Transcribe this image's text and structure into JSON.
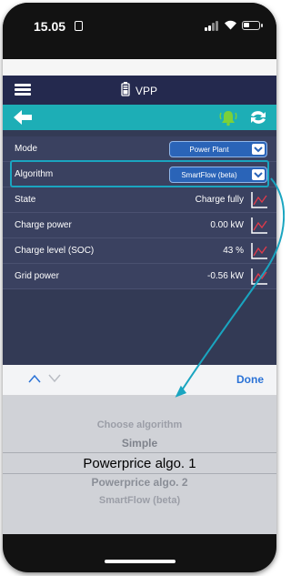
{
  "status_bar": {
    "time": "15.05"
  },
  "header": {
    "title": "VPP"
  },
  "settings": {
    "rows": [
      {
        "label": "Mode",
        "value": "Power Plant",
        "type": "select"
      },
      {
        "label": "Algorithm",
        "value": "SmartFlow (beta)",
        "type": "select"
      },
      {
        "label": "State",
        "value": "Charge fully",
        "type": "value"
      },
      {
        "label": "Charge power",
        "value": "0.00 kW",
        "type": "value"
      },
      {
        "label": "Charge level (SOC)",
        "value": "43 %",
        "type": "value"
      },
      {
        "label": "Grid power",
        "value": "-0.56 kW",
        "type": "value"
      }
    ]
  },
  "picker": {
    "done_label": "Done",
    "options": [
      "Choose algorithm",
      "Simple",
      "Powerprice algo. 1",
      "Powerprice algo. 2",
      "SmartFlow (beta)"
    ],
    "selected_index": 2
  },
  "colors": {
    "header_bg": "#24294e",
    "nav_bg": "#1daeb6",
    "panel_bg": "#333a55",
    "select_bg": "#2a64b8",
    "highlight": "#1aa5c0",
    "done": "#2a72d6"
  },
  "icons": {
    "menu": "hamburger-icon",
    "app": "battery-device-icon",
    "back": "arrow-left-icon",
    "alarm": "bell-icon",
    "refresh": "refresh-icon",
    "graph": "chart-line-icon",
    "chevron": "chevron-down-icon"
  }
}
